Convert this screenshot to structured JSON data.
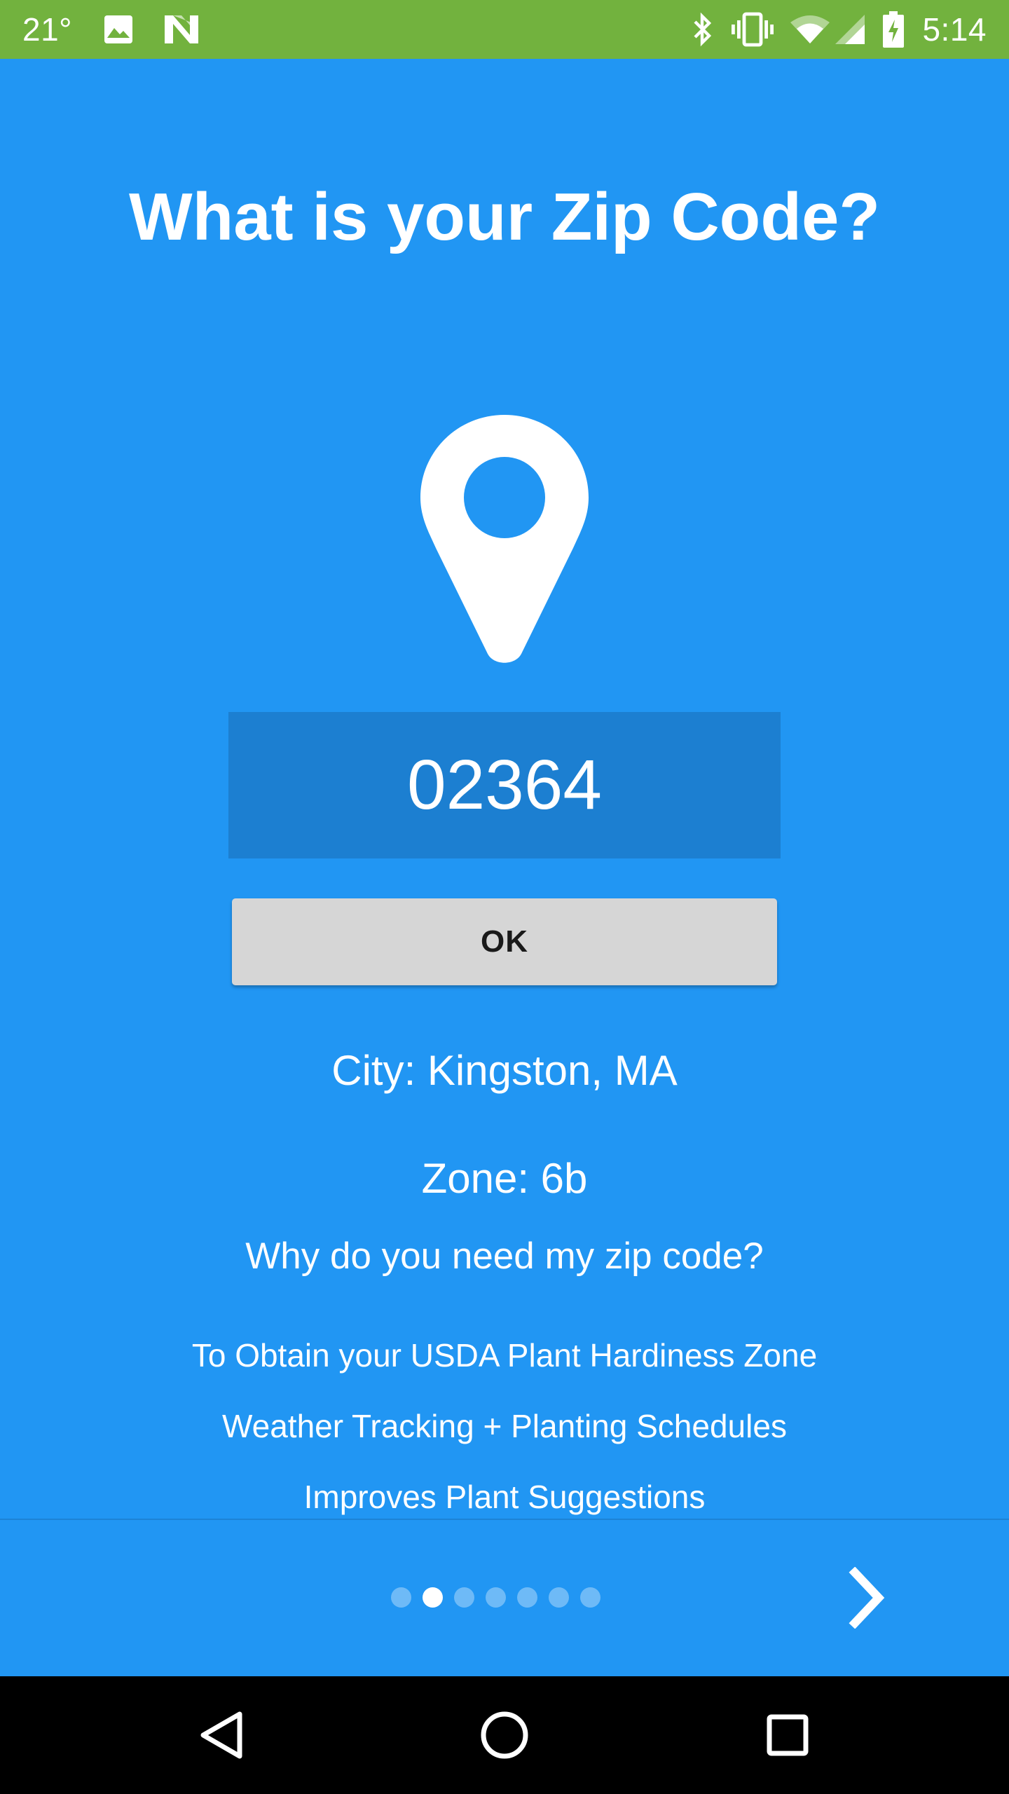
{
  "status_bar": {
    "temperature": "21°",
    "time": "5:14",
    "icons": [
      "image-icon",
      "n-app-icon",
      "bluetooth-icon",
      "vibrate-icon",
      "wifi-icon",
      "cell-signal-icon",
      "battery-charging-icon"
    ],
    "background_color": "#72B23E"
  },
  "page": {
    "title": "What is your Zip Code?",
    "icon": "map-pin-icon",
    "background_color": "#2196F3"
  },
  "zip": {
    "value": "02364"
  },
  "ok_button": {
    "label": "OK"
  },
  "location": {
    "city": "City: Kingston, MA",
    "zone": "Zone: 6b"
  },
  "why": {
    "question": "Why do you need my zip code?",
    "reasons": [
      "To Obtain your USDA Plant Hardiness Zone",
      "Weather Tracking + Planting Schedules",
      "Improves Plant Suggestions"
    ]
  },
  "pager": {
    "total_pages": 7,
    "current_page": 2
  },
  "nav_bar": {
    "buttons": [
      "back-icon",
      "home-icon",
      "recents-icon"
    ]
  }
}
